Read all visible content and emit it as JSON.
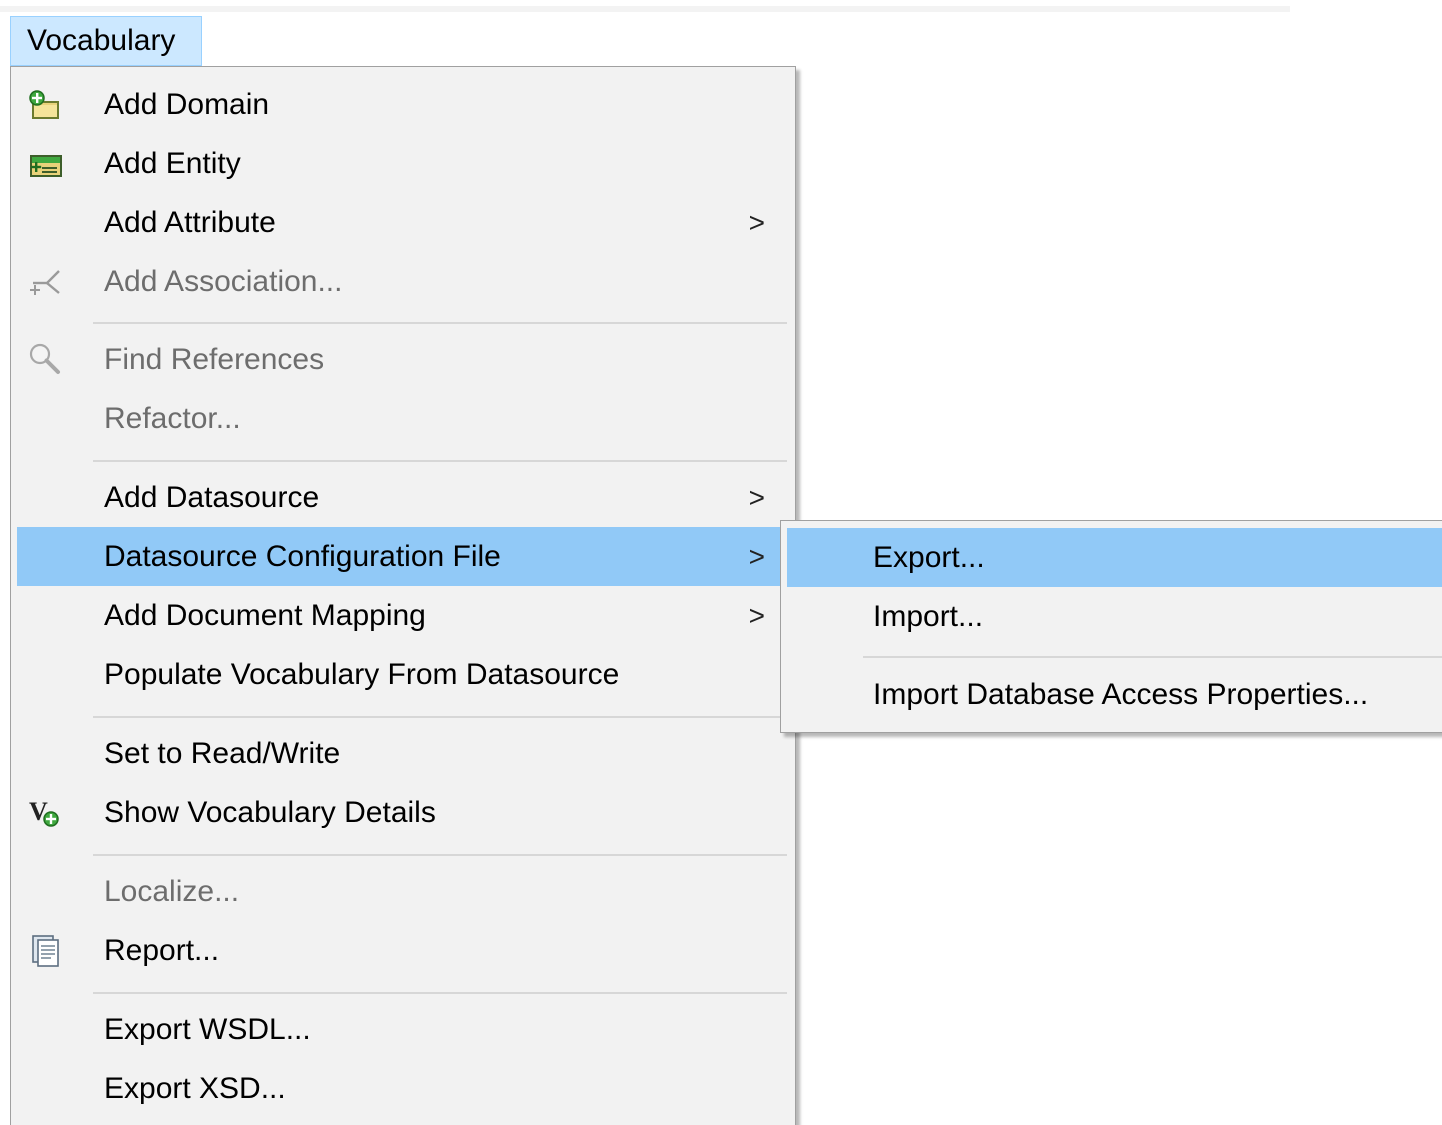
{
  "menubar": {
    "vocabulary_label": "Vocabulary"
  },
  "menu": {
    "items": {
      "add_domain": {
        "label": "Add Domain"
      },
      "add_entity": {
        "label": "Add Entity"
      },
      "add_attribute": {
        "label": "Add Attribute",
        "arrow": ">"
      },
      "add_association": {
        "label": "Add Association..."
      },
      "find_references": {
        "label": "Find References"
      },
      "refactor": {
        "label": "Refactor..."
      },
      "add_datasource": {
        "label": "Add Datasource",
        "arrow": ">"
      },
      "datasource_config": {
        "label": "Datasource Configuration File",
        "arrow": ">"
      },
      "add_document_mapping": {
        "label": "Add Document Mapping",
        "arrow": ">"
      },
      "populate_vocabulary": {
        "label": "Populate Vocabulary From Datasource"
      },
      "set_read_write": {
        "label": "Set to Read/Write"
      },
      "show_vocabulary_details": {
        "label": "Show Vocabulary Details"
      },
      "localize": {
        "label": "Localize..."
      },
      "report": {
        "label": "Report..."
      },
      "export_wsdl": {
        "label": "Export WSDL..."
      },
      "export_xsd": {
        "label": "Export XSD..."
      }
    }
  },
  "submenu": {
    "items": {
      "export": {
        "label": "Export..."
      },
      "import": {
        "label": "Import..."
      },
      "import_db_access": {
        "label": "Import Database Access Properties..."
      }
    }
  },
  "colors": {
    "highlight": "#91c9f7",
    "menubar_highlight": "#cce8ff",
    "menu_background": "#f2f2f2",
    "disabled_text": "#6d6d6d"
  }
}
